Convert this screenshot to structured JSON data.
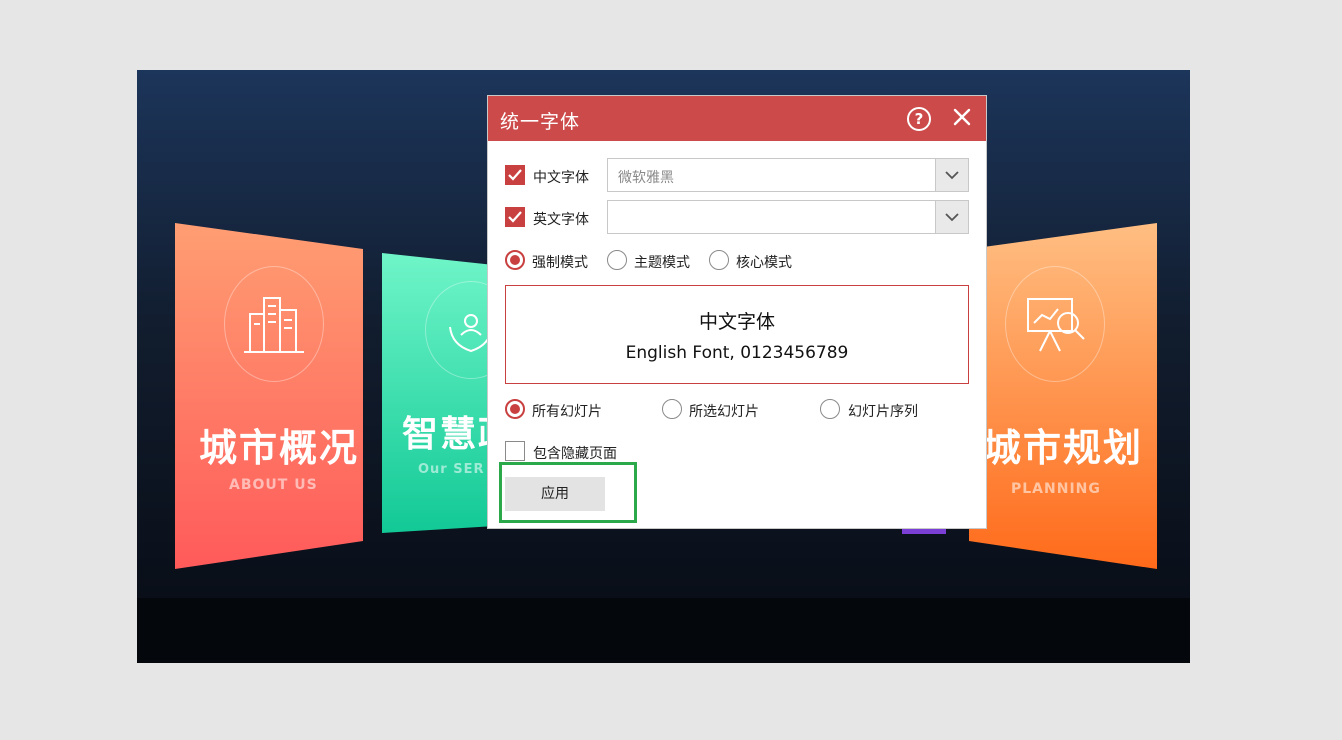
{
  "slide": {
    "cards": [
      {
        "title": "城市概况",
        "subtitle": "ABOUT US",
        "icon": "city-buildings-icon"
      },
      {
        "title": "智慧政",
        "subtitle": "Our SER",
        "icon": "people-hands-icon"
      },
      {
        "title": "城市规划",
        "subtitle": "PLANNING",
        "icon": "presentation-chart-icon"
      }
    ]
  },
  "dialog": {
    "title": "统一字体",
    "help_icon": "?",
    "chinese_font": {
      "label": "中文字体",
      "checked": true,
      "value": "微软雅黑"
    },
    "english_font": {
      "label": "英文字体",
      "checked": true,
      "value": ""
    },
    "modes": [
      {
        "label": "强制模式",
        "selected": true
      },
      {
        "label": "主题模式",
        "selected": false
      },
      {
        "label": "核心模式",
        "selected": false
      }
    ],
    "preview": {
      "chinese": "中文字体",
      "english": "English Font, 0123456789"
    },
    "scope": [
      {
        "label": "所有幻灯片",
        "selected": true
      },
      {
        "label": "所选幻灯片",
        "selected": false
      },
      {
        "label": "幻灯片序列",
        "selected": false
      }
    ],
    "include_hidden": {
      "label": "包含隐藏页面",
      "checked": false
    },
    "apply_label": "应用"
  },
  "colors": {
    "accent": "#cc4a4a",
    "highlight": "#2aa84a",
    "card1": [
      "#ff9e72",
      "#ff5a5a"
    ],
    "card2": [
      "#6ff5c8",
      "#12c996"
    ],
    "card3": [
      "#ffbe82",
      "#ff6a1a"
    ]
  }
}
